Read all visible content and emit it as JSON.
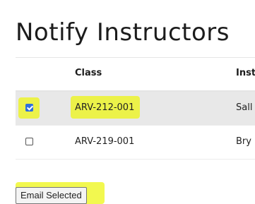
{
  "page": {
    "title": "Notify Instructors"
  },
  "table": {
    "headers": {
      "select": "",
      "class": "Class",
      "instructor": "Inst"
    },
    "rows": [
      {
        "checked": true,
        "class": "ARV-212-001",
        "instructor": "Sall"
      },
      {
        "checked": false,
        "class": "ARV-219-001",
        "instructor": "Bry"
      }
    ]
  },
  "actions": {
    "email_selected_label": "Email Selected"
  },
  "colors": {
    "highlight": "#eef514",
    "selected_row": "#e8e8e8",
    "checkbox_checked": "#2f6fde"
  }
}
